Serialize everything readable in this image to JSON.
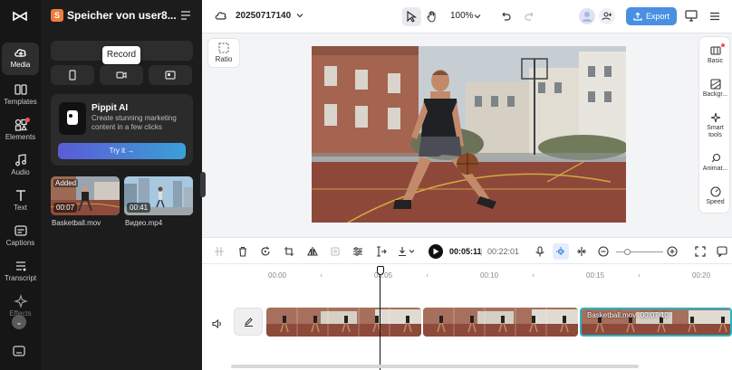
{
  "project": {
    "initial": "S",
    "name": "Speicher von user8..."
  },
  "rail": {
    "items": [
      {
        "label": "Media",
        "icon": "cloud-icon"
      },
      {
        "label": "Templates",
        "icon": "templates-icon"
      },
      {
        "label": "Elements",
        "icon": "elements-icon"
      },
      {
        "label": "Audio",
        "icon": "audio-icon"
      },
      {
        "label": "Text",
        "icon": "text-icon"
      },
      {
        "label": "Captions",
        "icon": "captions-icon"
      },
      {
        "label": "Transcript",
        "icon": "transcript-icon"
      },
      {
        "label": "Effects",
        "icon": "effects-icon"
      }
    ]
  },
  "panel": {
    "tooltip": "Record",
    "pippit": {
      "title": "Pippit AI",
      "description": "Create stunning marketing content in a few clicks",
      "cta": "Try it →"
    },
    "media": [
      {
        "badge": "Added",
        "duration": "00:07",
        "name": "Basketball.mov"
      },
      {
        "badge": "",
        "duration": "00:41",
        "name": "Видео.mp4"
      }
    ]
  },
  "topbar": {
    "title": "20250717140",
    "zoom": "100%",
    "export_label": "Export"
  },
  "canvas": {
    "ratio_label": "Ratio"
  },
  "right_rail": {
    "items": [
      {
        "label": "Basic",
        "icon": "basic-icon"
      },
      {
        "label": "Backgr...",
        "icon": "background-icon"
      },
      {
        "label": "Smart tools",
        "icon": "smart-tools-icon"
      },
      {
        "label": "Animat...",
        "icon": "animation-icon"
      },
      {
        "label": "Speed",
        "icon": "speed-icon"
      }
    ]
  },
  "timeline": {
    "current_time": "00:05:11",
    "separator": "|",
    "total_time": "00:22:01",
    "ruler": [
      "00:00",
      "00:05",
      "00:10",
      "00:15",
      "00:20"
    ],
    "clip_label": "Basketball.mov",
    "clip_duration": "00:07:10"
  },
  "colors": {
    "accent": "#4a90e2",
    "selection": "#2ab3c0",
    "dark_panel": "#1c1c1c"
  }
}
